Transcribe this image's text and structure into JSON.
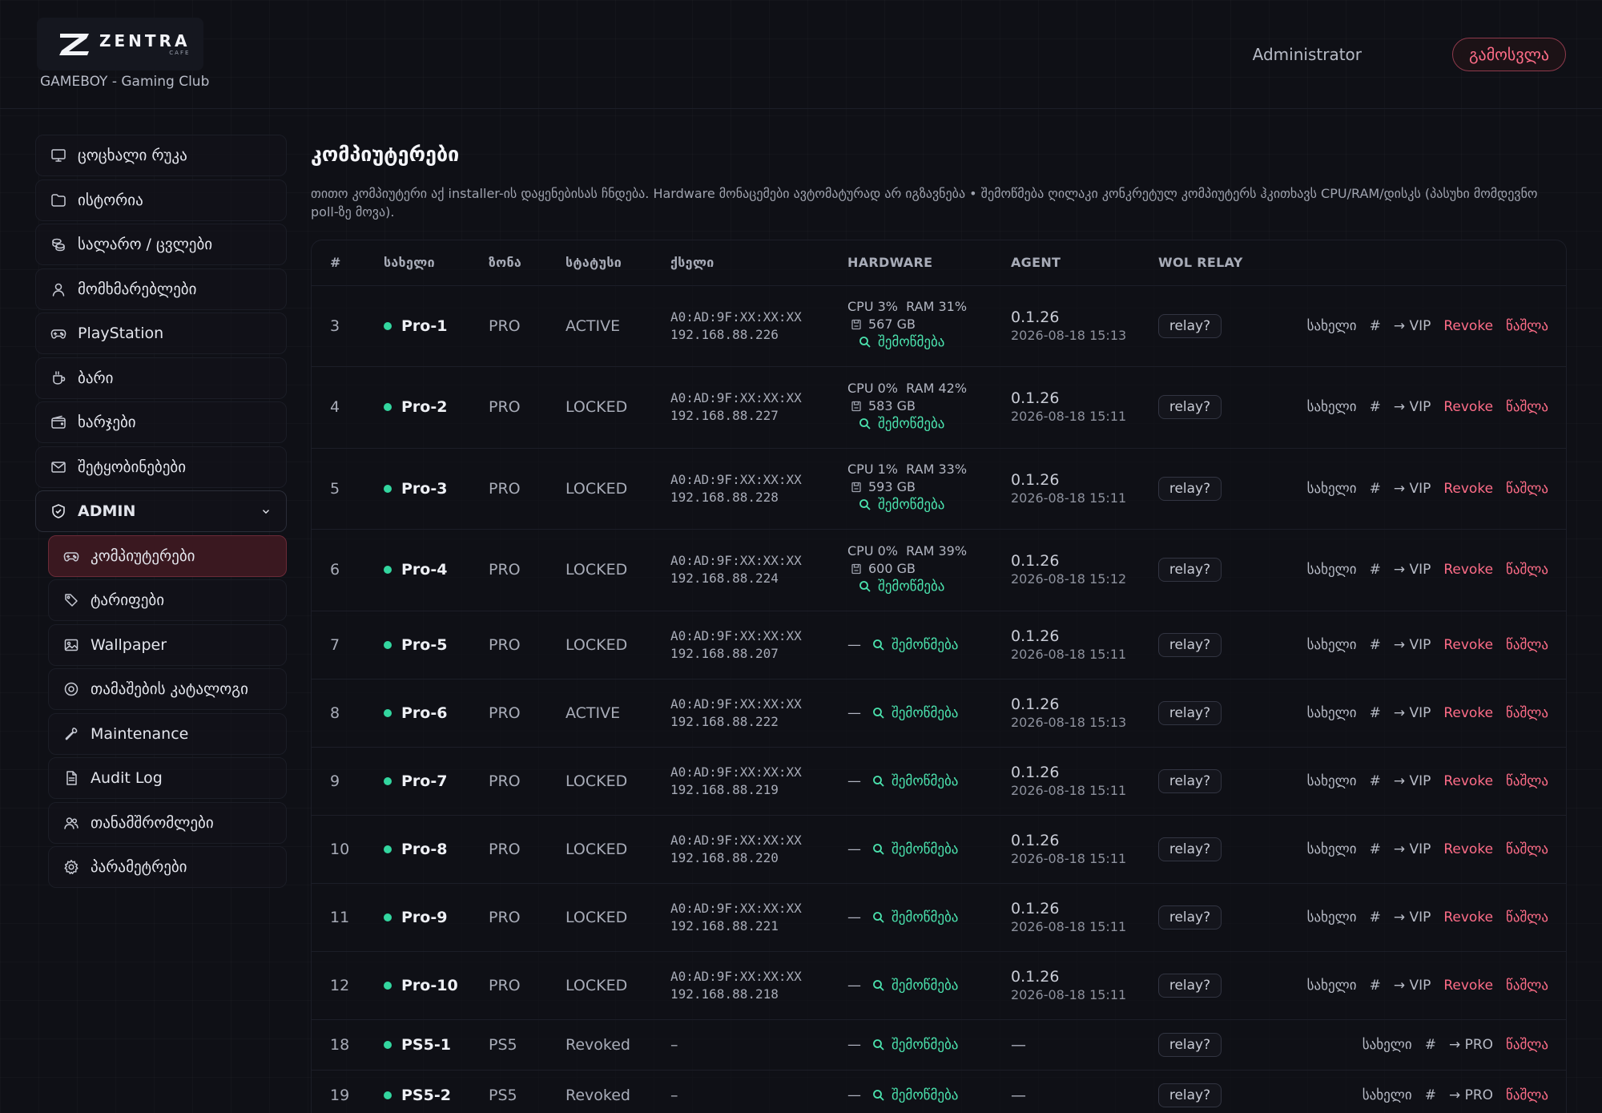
{
  "header": {
    "logo_name": "ZENTRA",
    "logo_sub": "CAFE",
    "club_name": "GAMEBOY - Gaming Club",
    "user": "Administrator",
    "logout": "გამოსვლა"
  },
  "sidebar": {
    "items": [
      {
        "label": "ცოცხალი რუკა",
        "icon": "monitor-icon"
      },
      {
        "label": "ისტორია",
        "icon": "folder-icon"
      },
      {
        "label": "სალარო / ცვლები",
        "icon": "coins-icon"
      },
      {
        "label": "მომხმარებლები",
        "icon": "user-icon"
      },
      {
        "label": "PlayStation",
        "icon": "gamepad-icon"
      },
      {
        "label": "ბარი",
        "icon": "cup-icon"
      },
      {
        "label": "ხარჯები",
        "icon": "wallet-icon"
      },
      {
        "label": "შეტყობინებები",
        "icon": "mail-icon"
      }
    ],
    "admin_label": "ADMIN",
    "admin_items": [
      {
        "label": "კომპიუტერები",
        "icon": "gamepad-icon",
        "active": true
      },
      {
        "label": "ტარიფები",
        "icon": "tag-icon"
      },
      {
        "label": "Wallpaper",
        "icon": "image-icon"
      },
      {
        "label": "თამაშების კატალოგი",
        "icon": "disc-icon"
      },
      {
        "label": "Maintenance",
        "icon": "wrench-icon"
      },
      {
        "label": "Audit Log",
        "icon": "file-icon"
      },
      {
        "label": "თანამშრომლები",
        "icon": "users-icon"
      },
      {
        "label": "პარამეტრები",
        "icon": "gear-icon"
      }
    ]
  },
  "main": {
    "title": "კომპიუტერები",
    "description": "თითო კომპიუტერი აქ installer-ის დაყენებისას ჩნდება. Hardware მონაცემები ავტომატურად არ იგზავნება • შემოწმება ღილაკი კონკრეტულ კომპიუტერს ჰკითხავს CPU/RAM/დისკს (პასუხი მომდევნო poll-ზე მოვა).",
    "columns": [
      "#",
      "სახელი",
      "ზონა",
      "სტატუსი",
      "ქსელი",
      "HARDWARE",
      "AGENT",
      "WOL RELAY"
    ],
    "check_label": "შემოწმება",
    "relay_label": "relay?",
    "action_name": "სახელი",
    "action_hash": "#",
    "action_revoke": "Revoke",
    "action_delete": "წაშლა",
    "rows": [
      {
        "num": "3",
        "name": "Pro-1",
        "zone": "PRO",
        "status": "ACTIVE",
        "mac": "A0:AD:9F:XX:XX:XX",
        "ip": "192.168.88.226",
        "cpu": "CPU 3%",
        "ram": "RAM 31%",
        "disk": "567 GB",
        "agent": "0.1.26",
        "agent_time": "2026-08-18 15:13",
        "move": "→ VIP"
      },
      {
        "num": "4",
        "name": "Pro-2",
        "zone": "PRO",
        "status": "LOCKED",
        "mac": "A0:AD:9F:XX:XX:XX",
        "ip": "192.168.88.227",
        "cpu": "CPU 0%",
        "ram": "RAM 42%",
        "disk": "583 GB",
        "agent": "0.1.26",
        "agent_time": "2026-08-18 15:11",
        "move": "→ VIP"
      },
      {
        "num": "5",
        "name": "Pro-3",
        "zone": "PRO",
        "status": "LOCKED",
        "mac": "A0:AD:9F:XX:XX:XX",
        "ip": "192.168.88.228",
        "cpu": "CPU 1%",
        "ram": "RAM 33%",
        "disk": "593 GB",
        "agent": "0.1.26",
        "agent_time": "2026-08-18 15:11",
        "move": "→ VIP"
      },
      {
        "num": "6",
        "name": "Pro-4",
        "zone": "PRO",
        "status": "LOCKED",
        "mac": "A0:AD:9F:XX:XX:XX",
        "ip": "192.168.88.224",
        "cpu": "CPU 0%",
        "ram": "RAM 39%",
        "disk": "600 GB",
        "agent": "0.1.26",
        "agent_time": "2026-08-18 15:12",
        "move": "→ VIP"
      },
      {
        "num": "7",
        "name": "Pro-5",
        "zone": "PRO",
        "status": "LOCKED",
        "mac": "A0:AD:9F:XX:XX:XX",
        "ip": "192.168.88.207",
        "hw_dash": "—",
        "agent": "0.1.26",
        "agent_time": "2026-08-18 15:11",
        "move": "→ VIP"
      },
      {
        "num": "8",
        "name": "Pro-6",
        "zone": "PRO",
        "status": "ACTIVE",
        "mac": "A0:AD:9F:XX:XX:XX",
        "ip": "192.168.88.222",
        "hw_dash": "—",
        "agent": "0.1.26",
        "agent_time": "2026-08-18 15:13",
        "move": "→ VIP"
      },
      {
        "num": "9",
        "name": "Pro-7",
        "zone": "PRO",
        "status": "LOCKED",
        "mac": "A0:AD:9F:XX:XX:XX",
        "ip": "192.168.88.219",
        "hw_dash": "—",
        "agent": "0.1.26",
        "agent_time": "2026-08-18 15:11",
        "move": "→ VIP"
      },
      {
        "num": "10",
        "name": "Pro-8",
        "zone": "PRO",
        "status": "LOCKED",
        "mac": "A0:AD:9F:XX:XX:XX",
        "ip": "192.168.88.220",
        "hw_dash": "—",
        "agent": "0.1.26",
        "agent_time": "2026-08-18 15:11",
        "move": "→ VIP"
      },
      {
        "num": "11",
        "name": "Pro-9",
        "zone": "PRO",
        "status": "LOCKED",
        "mac": "A0:AD:9F:XX:XX:XX",
        "ip": "192.168.88.221",
        "hw_dash": "—",
        "agent": "0.1.26",
        "agent_time": "2026-08-18 15:11",
        "move": "→ VIP"
      },
      {
        "num": "12",
        "name": "Pro-10",
        "zone": "PRO",
        "status": "LOCKED",
        "mac": "A0:AD:9F:XX:XX:XX",
        "ip": "192.168.88.218",
        "hw_dash": "—",
        "agent": "0.1.26",
        "agent_time": "2026-08-18 15:11",
        "move": "→ VIP"
      },
      {
        "num": "18",
        "name": "PS5-1",
        "zone": "PS5",
        "status": "Revoked",
        "mac_dash": "–",
        "hw_dash": "—",
        "agent_dash": "—",
        "move": "→ PRO",
        "revoked": true
      },
      {
        "num": "19",
        "name": "PS5-2",
        "zone": "PS5",
        "status": "Revoked",
        "mac_dash": "–",
        "hw_dash": "—",
        "agent_dash": "—",
        "move": "→ PRO",
        "revoked": true
      }
    ]
  },
  "colors": {
    "background": "#0f1016",
    "accent_red": "#ff6d88",
    "online_green": "#33d69f",
    "check_green": "#4be3ae",
    "active_nav_bg": "#3a1820"
  }
}
